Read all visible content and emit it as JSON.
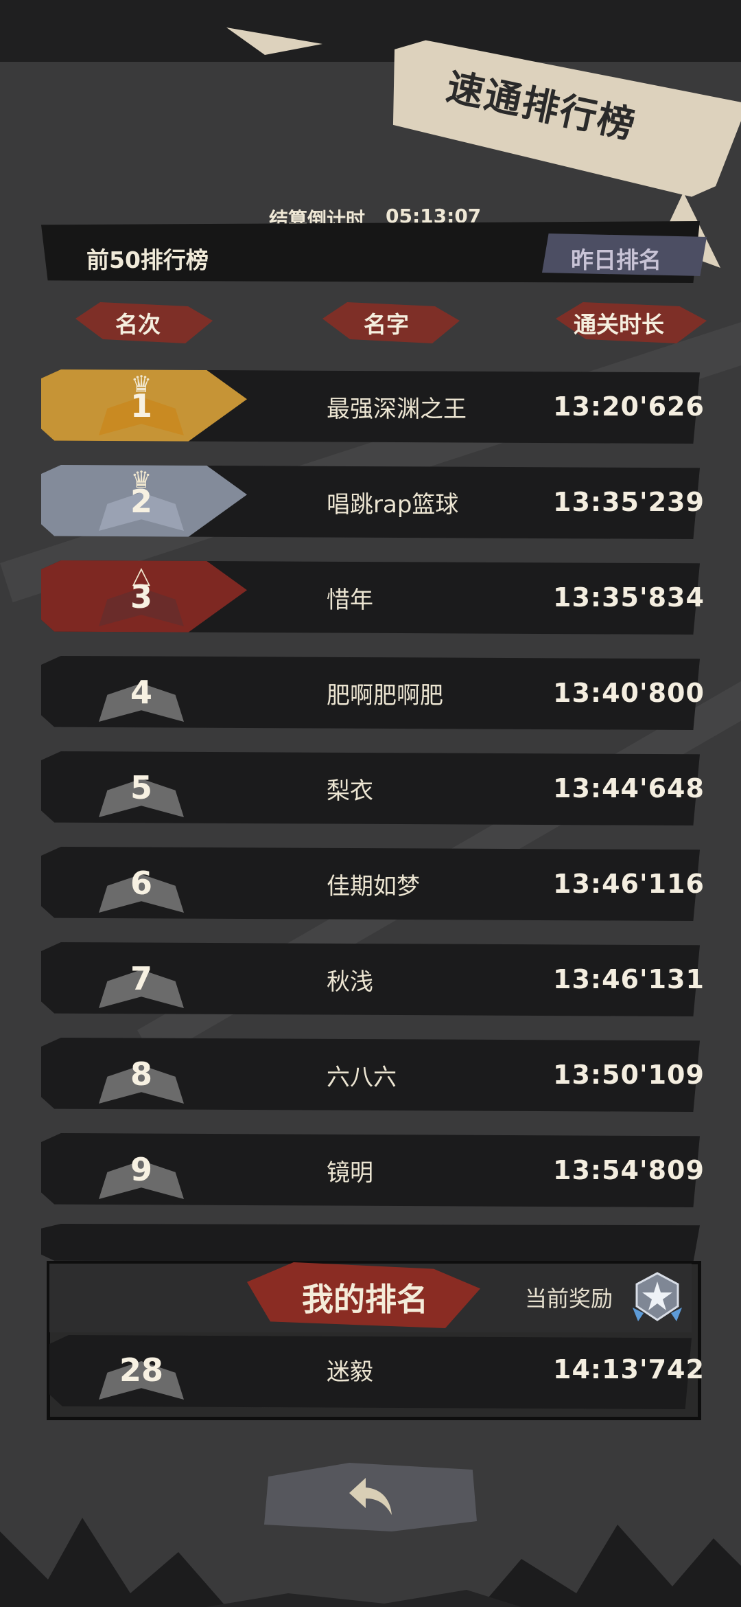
{
  "header": {
    "title": "速通排行榜",
    "countdown_label": "结算倒计时",
    "countdown_value": "05:13:07",
    "top50_label": "前50排行榜",
    "yesterday_button": "昨日排名"
  },
  "columns": {
    "rank": "名次",
    "name": "名字",
    "time": "通关时长"
  },
  "rows": [
    {
      "rank": "1",
      "name": "最强深渊之王",
      "time": "13:20'626",
      "badge": "gold"
    },
    {
      "rank": "2",
      "name": "唱跳rap篮球",
      "time": "13:35'239",
      "badge": "silver"
    },
    {
      "rank": "3",
      "name": "惜年",
      "time": "13:35'834",
      "badge": "bronze"
    },
    {
      "rank": "4",
      "name": "肥啊肥啊肥",
      "time": "13:40'800",
      "badge": "normal"
    },
    {
      "rank": "5",
      "name": "梨衣",
      "time": "13:44'648",
      "badge": "normal"
    },
    {
      "rank": "6",
      "name": "佳期如梦",
      "time": "13:46'116",
      "badge": "normal"
    },
    {
      "rank": "7",
      "name": "秋浅",
      "time": "13:46'131",
      "badge": "normal"
    },
    {
      "rank": "8",
      "name": "六八六",
      "time": "13:50'109",
      "badge": "normal"
    },
    {
      "rank": "9",
      "name": "镜明",
      "time": "13:54'809",
      "badge": "normal"
    }
  ],
  "my_rank": {
    "title": "我的排名",
    "reward_label": "当前奖励",
    "reward_icon": "silver-star-badge-icon",
    "rank": "28",
    "name": "迷毅",
    "time": "14:13'742"
  },
  "footer": {
    "back_icon": "back-arrow-icon"
  },
  "colors": {
    "gold": "#d9a23a",
    "silver": "#8f98a8",
    "bronze": "#8a2a24",
    "accent_red": "#8b2e25",
    "row_bg": "#1b1b1c"
  }
}
